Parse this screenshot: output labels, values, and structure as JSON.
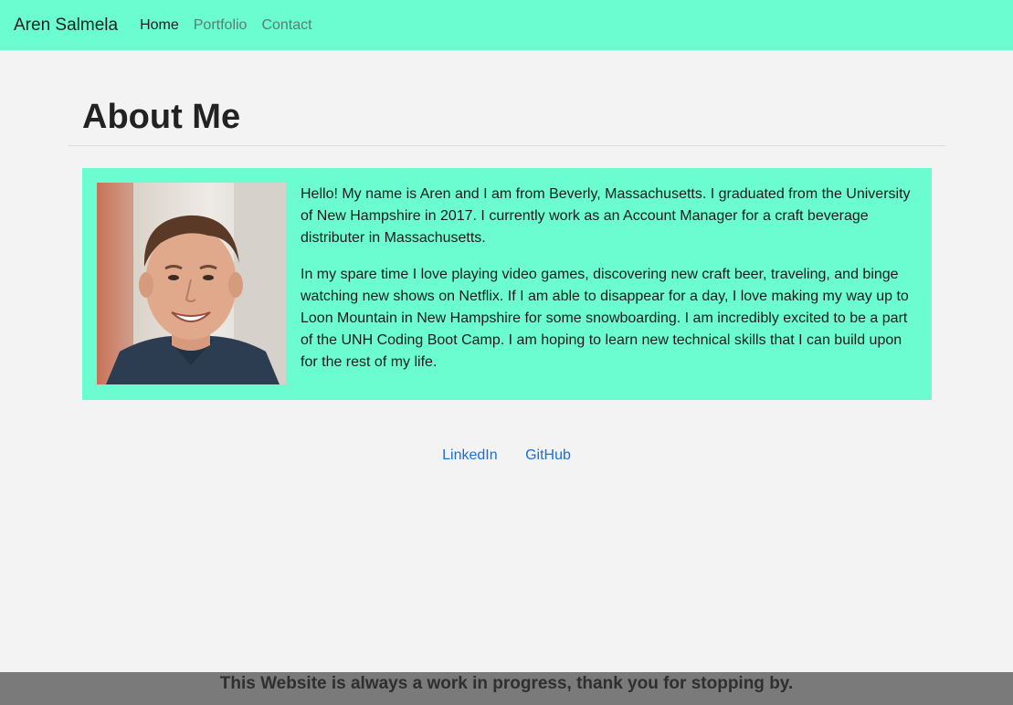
{
  "nav": {
    "brand": "Aren Salmela",
    "links": [
      "Home",
      "Portfolio",
      "Contact"
    ],
    "active": "Home"
  },
  "page": {
    "heading": "About Me"
  },
  "about": {
    "paragraphs": [
      "Hello! My name is Aren and I am from Beverly, Massachusetts. I graduated from the University of New Hampshire in 2017. I currently work as an Account Manager for a craft beverage distributer in Massachusetts.",
      "In my spare time I love playing video games, discovering new craft beer, traveling, and binge watching new shows on Netflix. If I am able to disappear for a day, I love making my way up to Loon Mountain in New Hampshire for some snowboarding. I am incredibly excited to be a part of the UNH Coding Boot Camp. I am hoping to learn new technical skills that I can build upon for the rest of my life."
    ]
  },
  "social": {
    "linkedin": "LinkedIn",
    "github": "GitHub"
  },
  "footer": {
    "text": "This Website is always a work in progress, thank you for stopping by."
  },
  "colors": {
    "accent": "#6bfdcf",
    "background": "#f3f3f3",
    "link": "#1a6fe0",
    "footer": "#7a7a7a"
  }
}
